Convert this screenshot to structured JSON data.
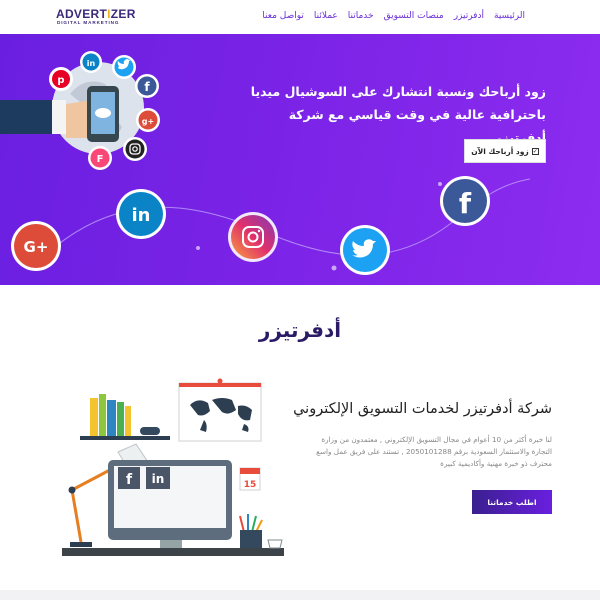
{
  "logo": {
    "text_a": "ADVERT",
    "text_b": "I",
    "text_c": "ZER",
    "sub": "DIGITAL MARKETING"
  },
  "nav": {
    "items": [
      {
        "label": "الرئيسية"
      },
      {
        "label": "أدفرتيزر"
      },
      {
        "label": "منصات التسويق"
      },
      {
        "label": "خدماتنا"
      },
      {
        "label": "عملائنا"
      },
      {
        "label": "تواصل معنا"
      }
    ]
  },
  "hero": {
    "title": "زود أرباحك ونسبة انتشارك على السوشيال ميديا باحترافية عالية في وقت قياسي مع شركة أدفرتيزر.",
    "cta": "زود أرباحك الآن",
    "bubbles": {
      "google_plus": "G+",
      "linkedin": "in",
      "facebook": "f",
      "twitter": "twitter-icon",
      "instagram": "instagram-icon"
    }
  },
  "about": {
    "title": "أدفرتيزر",
    "subtitle": "شركة أدفرتيزر لخدمات التسويق الإلكتروني",
    "text": "لنا خبرة أكثر من 10 أعوام في مجال التسويق الإلكتروني , معتمدون من وزارة التجارة والاستثمار السعودية برقم 2050101288 , تستند على فريق عمل واسع محترف ذو خبرة مهنية وأكاديمية كبيرة",
    "cta": "اطلب خدماتنا",
    "calendar_day": "15",
    "screen_icons": {
      "facebook": "f",
      "linkedin": "in"
    }
  },
  "colors": {
    "brand_purple": "#6a1fe0",
    "brand_dark": "#2b1b66",
    "logo_gold": "#f2b01e",
    "facebook": "#3b5998",
    "linkedin": "#0a84c6",
    "twitter": "#1da1f2",
    "google_plus": "#dd4b39"
  }
}
